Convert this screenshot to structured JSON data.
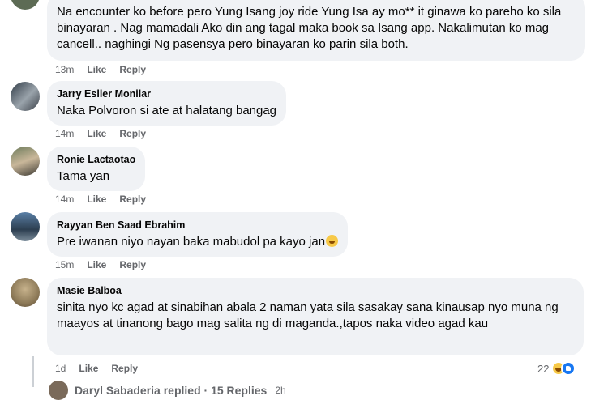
{
  "comments": [
    {
      "author": "",
      "text": "Na encounter ko before pero Yung Isang joy ride Yung Isa ay mo** it ginawa ko pareho ko sila binayaran . Nag mamadali Ako din ang tagal maka book sa Isang app. Nakalimutan ko mag cancell.. naghingi Ng pasensya pero binayaran ko parin sila both.",
      "time": "13m",
      "like": "Like",
      "reply": "Reply"
    },
    {
      "author": "Jarry Esller Monilar",
      "text": "Naka Polvoron si ate at halatang bangag",
      "time": "14m",
      "like": "Like",
      "reply": "Reply"
    },
    {
      "author": "Ronie Lactaotao",
      "text": "Tama yan",
      "time": "14m",
      "like": "Like",
      "reply": "Reply"
    },
    {
      "author": "Rayyan Ben Saad Ebrahim",
      "text": "Pre iwanan niyo nayan baka mabudol pa kayo jan",
      "time": "15m",
      "like": "Like",
      "reply": "Reply"
    },
    {
      "author": "Masie Balboa",
      "text": "sinita nyo kc agad at sinabihan abala 2 naman yata sila sasakay sana kinausap nyo muna ng maayos at tinanong bago mag salita ng di maganda.,tapos naka video agad kau",
      "time": "1d",
      "like": "Like",
      "reply": "Reply",
      "reaction_count": "22"
    }
  ],
  "reply_preview": {
    "text": "Daryl Sabaderia replied · 15 Replies",
    "time": "2h"
  },
  "colors": {
    "bubble": "#f0f2f5",
    "meta": "#65676b",
    "like_blue": "#1877f2"
  }
}
